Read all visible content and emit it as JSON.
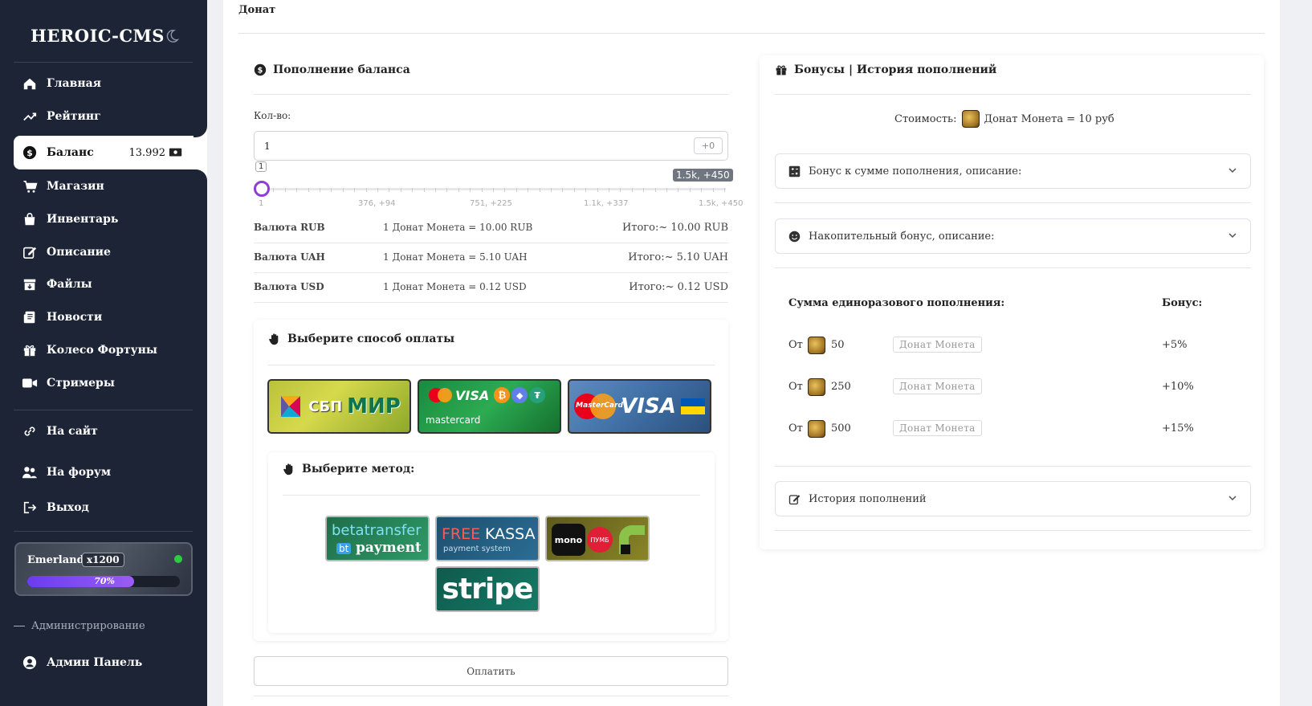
{
  "sidebar": {
    "brand": "HEROIC-CMS",
    "nav": [
      {
        "label": "Главная",
        "icon": "home-icon"
      },
      {
        "label": "Рейтинг",
        "icon": "trend-icon"
      },
      {
        "label": "Баланс",
        "icon": "dollar-icon",
        "value": "13.992"
      },
      {
        "label": "Магазин",
        "icon": "cart-icon"
      },
      {
        "label": "Инвентарь",
        "icon": "bag-icon"
      },
      {
        "label": "Описание",
        "icon": "edit-icon"
      },
      {
        "label": "Файлы",
        "icon": "box-icon"
      },
      {
        "label": "Новости",
        "icon": "news-icon"
      },
      {
        "label": "Колесо Фортуны",
        "icon": "gift-icon"
      },
      {
        "label": "Стримеры",
        "icon": "video-icon"
      }
    ],
    "links": [
      {
        "label": "На сайт",
        "icon": "link-icon"
      },
      {
        "label": "На форум",
        "icon": "users-icon"
      },
      {
        "label": "Выход",
        "icon": "logout-icon"
      }
    ],
    "server": {
      "name": "Emerland",
      "rate": "x1200",
      "progress_label": "70%",
      "progress": 70
    },
    "admin_section": "Администрирование",
    "admin_panel": "Админ Панель"
  },
  "page": {
    "title": "Донат"
  },
  "topup": {
    "title": "Пополнение баланса",
    "qty_label": "Кол-во:",
    "qty_value": "1",
    "bonus_chip": "+0",
    "slider": {
      "value": 1,
      "min": 1,
      "max": 1500,
      "value_tip": "1",
      "max_tip": "1.5k, +450",
      "tick_labels": [
        "1",
        "376, +94",
        "751, +225",
        "1.1k, +337",
        "1.5k, +450"
      ]
    },
    "currencies": [
      {
        "name": "Валюта RUB",
        "rate": "1 Донат Монета = 10.00 RUB",
        "total": "Итого:~ 10.00 RUB"
      },
      {
        "name": "Валюта UAH",
        "rate": "1 Донат Монета = 5.10 UAH",
        "total": "Итого:~ 5.10 UAH"
      },
      {
        "name": "Валюта USD",
        "rate": "1 Донат Монета = 0.12 USD",
        "total": "Итого:~ 0.12 USD"
      }
    ],
    "pay_way_title": "Выберите способ оплаты",
    "pay_ways": [
      {
        "text1": "СБП",
        "text2": "МИР"
      },
      {
        "text1": "VISA",
        "text2": "mastercard"
      },
      {
        "text1": "MasterCard",
        "text2": "VISA"
      }
    ],
    "method_title": "Выберите метод:",
    "methods": {
      "beta_1": "betatransfer",
      "beta_badge": "bt",
      "beta_2": "payment",
      "free_1": "FREE",
      "free_2": "KASSA",
      "free_sub": "payment system",
      "mono": "mono",
      "pumb": "ПУМБ",
      "stripe": "stripe"
    },
    "pay_button": "Оплатить"
  },
  "bonuses": {
    "title": "Бонусы | История пополнений",
    "cost_label": "Стоимость:",
    "cost_value": "Донат Монета = 10 руб",
    "acc_sum_bonus": "Бонус к сумме пополнения, описание:",
    "acc_cumulative": "Накопительный бонус, описание:",
    "col_sum": "Сумма единоразового пополнения:",
    "col_bonus": "Бонус:",
    "rows": [
      {
        "from": "От",
        "amount": "50",
        "currency": "Донат Монета",
        "bonus": "+5%"
      },
      {
        "from": "От",
        "amount": "250",
        "currency": "Донат Монета",
        "bonus": "+10%"
      },
      {
        "from": "От",
        "amount": "500",
        "currency": "Донат Монета",
        "bonus": "+15%"
      }
    ],
    "history": "История пополнений"
  },
  "colors": {
    "sidebar_bg": "#1c2436",
    "accent_purple": "#8e3ed6"
  }
}
